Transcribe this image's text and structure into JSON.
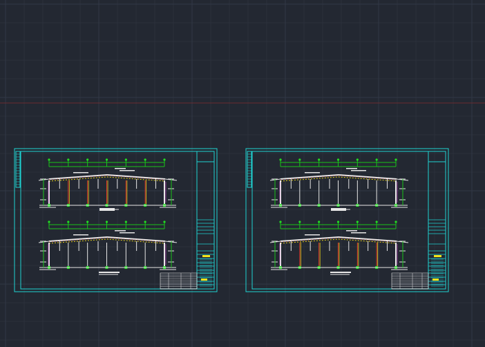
{
  "app": {
    "kind": "cad-model-space"
  },
  "colors": {
    "background": "#232832",
    "grid_minor": "#2b303b",
    "grid_major": "#323846",
    "axis_x": "#6b2c30",
    "axis_y": "#2d4a4a",
    "frame": "#1fd3d3",
    "structure": "#e8e8e8",
    "dimension": "#18c418",
    "node": "#22dd22",
    "member_red": "#e23b2b",
    "member_yellow": "#e8d21c",
    "accent_magenta": "#d24bd2",
    "title_highlight": "#f4e51a"
  },
  "sheets": [
    {
      "id": "sheet-1",
      "elevations": 2,
      "bays": 6
    },
    {
      "id": "sheet-2",
      "elevations": 2,
      "bays": 6
    }
  ]
}
